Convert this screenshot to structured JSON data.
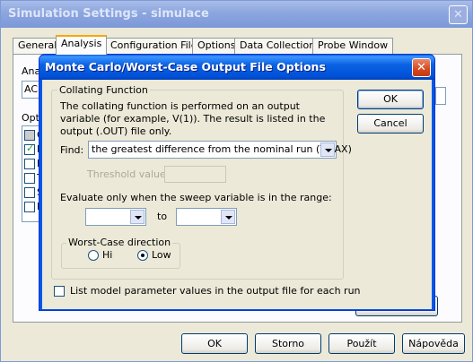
{
  "background_window": {
    "title": "Simulation Settings - simulace",
    "tabs": [
      "General",
      "Analysis",
      "Configuration Files",
      "Options",
      "Data Collection",
      "Probe Window"
    ],
    "active_tab": "Analysis",
    "label_analysis": "Ana",
    "analysis_value": "AC",
    "label_options": "Opti",
    "options": [
      {
        "letter": "G",
        "state": "grey"
      },
      {
        "letter": "M",
        "state": "checked"
      },
      {
        "letter": "P",
        "state": "unchecked"
      },
      {
        "letter": "T",
        "state": "unchecked"
      },
      {
        "letter": "S",
        "state": "unchecked"
      },
      {
        "letter": "L",
        "state": "unchecked"
      }
    ],
    "buttons": {
      "ok": "OK",
      "cancel": "Storno",
      "apply": "Použít",
      "help": "Nápověda"
    }
  },
  "dialog": {
    "title": "Monte Carlo/Worst-Case Output File Options",
    "collating_group": "Collating Function",
    "description": "The collating function is performed on an output variable (for example,  V(1)).  The result is listed in the output (.OUT) file only.",
    "find_label": "Find:",
    "find_value": "the greatest difference from the nominal run (YMAX)",
    "threshold_label": "Threshold value:",
    "threshold_value": "",
    "range_label": "Evaluate only when the sweep variable is in the range:",
    "range_from": "",
    "to_label": "to",
    "range_to": "",
    "direction_group": "Worst-Case direction",
    "direction_hi": "Hi",
    "direction_low": "Low",
    "direction_selected": "Low",
    "list_params_label": "List model parameter values in the output file for each run",
    "list_params_checked": false,
    "ok_label": "OK",
    "cancel_label": "Cancel"
  }
}
